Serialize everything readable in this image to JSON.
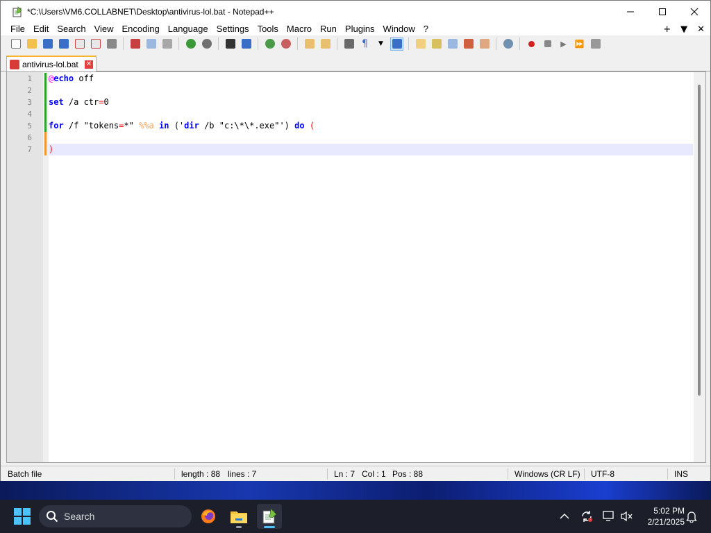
{
  "window": {
    "title": "*C:\\Users\\VM6.COLLABNET\\Desktop\\antivirus-lol.bat - Notepad++"
  },
  "menu": {
    "items": [
      "File",
      "Edit",
      "Search",
      "View",
      "Encoding",
      "Language",
      "Settings",
      "Tools",
      "Macro",
      "Run",
      "Plugins",
      "Window",
      "?"
    ],
    "right": [
      "+",
      "▼",
      "✕"
    ]
  },
  "toolbar": {
    "icons": [
      "new-file",
      "open-file",
      "save",
      "save-all",
      "close",
      "close-all",
      "print",
      "cut",
      "copy",
      "paste",
      "undo",
      "redo",
      "find",
      "replace",
      "zoom-in",
      "zoom-out",
      "sync-vertical",
      "sync-horizontal",
      "word-wrap",
      "show-all-characters",
      "indent-guide",
      "function-list",
      "doc-map",
      "folder-as-workspace",
      "monitoring",
      "record-macro",
      "stop-macro",
      "play-macro",
      "run-macro-multiple",
      "save-macro"
    ]
  },
  "tab": {
    "name": "antivirus-lol.bat"
  },
  "editor": {
    "line_numbers": [
      "1",
      "2",
      "3",
      "4",
      "5",
      "6",
      "7"
    ],
    "lines": [
      {
        "segments": [
          {
            "t": "@",
            "c": "at"
          },
          {
            "t": "echo",
            "c": "kw"
          },
          {
            "t": " off",
            "c": ""
          }
        ]
      },
      {
        "segments": []
      },
      {
        "segments": [
          {
            "t": "set",
            "c": "kw"
          },
          {
            "t": " /a ctr",
            "c": ""
          },
          {
            "t": "=",
            "c": "op"
          },
          {
            "t": "0",
            "c": ""
          }
        ]
      },
      {
        "segments": []
      },
      {
        "segments": [
          {
            "t": "for",
            "c": "kw"
          },
          {
            "t": " /f \"tokens",
            "c": ""
          },
          {
            "t": "=",
            "c": "op"
          },
          {
            "t": "*\" ",
            "c": ""
          },
          {
            "t": "%%a",
            "c": "var"
          },
          {
            "t": " ",
            "c": ""
          },
          {
            "t": "in",
            "c": "kw"
          },
          {
            "t": " ('",
            "c": ""
          },
          {
            "t": "dir",
            "c": "kw"
          },
          {
            "t": " /b \"c:\\*\\*.exe\"') ",
            "c": ""
          },
          {
            "t": "do",
            "c": "kw"
          },
          {
            "t": " ",
            "c": ""
          },
          {
            "t": "(",
            "c": "op"
          }
        ]
      },
      {
        "segments": []
      },
      {
        "segments": [
          {
            "t": ")",
            "c": "op"
          }
        ]
      }
    ],
    "current_line": 7
  },
  "status": {
    "language": "Batch file",
    "length": "length : 88",
    "lines": "lines : 7",
    "ln": "Ln : 7",
    "col": "Col : 1",
    "pos": "Pos : 88",
    "eol": "Windows (CR LF)",
    "encoding": "UTF-8",
    "mode": "INS"
  },
  "taskbar": {
    "search_label": "Search",
    "time": "5:02 PM",
    "date": "2/21/2025"
  }
}
